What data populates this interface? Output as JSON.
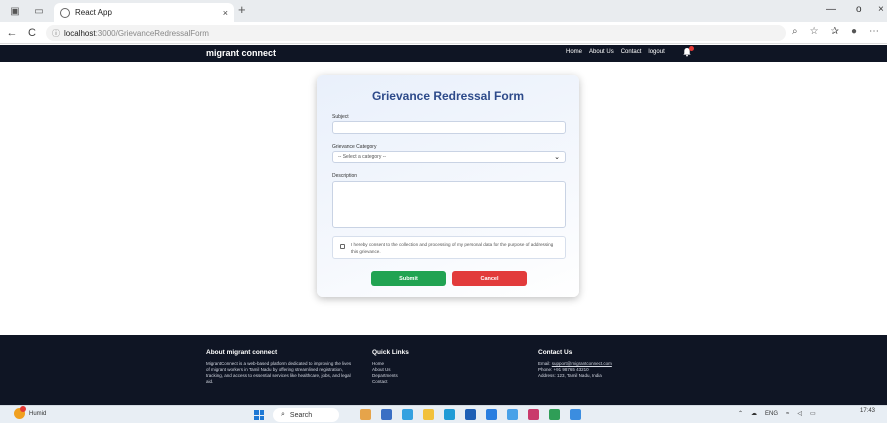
{
  "browser": {
    "tab_title": "React App",
    "tab_close": "×",
    "new_tab": "+",
    "url_host": "localhost",
    "url_path": ":3000/GrievanceRedressalForm",
    "back": "←",
    "reload": "C",
    "minimize": "—",
    "restore": "o",
    "close": "×"
  },
  "navbar": {
    "brand": "migrant connect",
    "links": [
      "Home",
      "About Us",
      "Contact",
      "logout"
    ]
  },
  "form": {
    "title": "Grievance Redressal Form",
    "subject_label": "Subject",
    "category_label": "Grievance Category",
    "category_selected": "-- Select a category --",
    "description_label": "Description",
    "consent_text": "I hereby consent to the collection and processing of my personal data for the purpose of addressing this grievance.",
    "submit_label": "Submit",
    "cancel_label": "Cancel",
    "submit_color": "#21a352",
    "cancel_color": "#e23b3b"
  },
  "footer": {
    "about_title": "About migrant connect",
    "about_text": "MigrantConnect is a web-based platform dedicated to improving the lives of migrant workers in Tamil Nadu by offering streamlined registration, tracking, and access to essential services like healthcare, jobs, and legal aid.",
    "links_title": "Quick Links",
    "links": [
      "Home",
      "About Us",
      "Departments",
      "Contact"
    ],
    "contact_title": "Contact Us",
    "email_label": "Email: ",
    "email": "support@migrantconnect.com",
    "phone": "Phone: +91 98765 43210",
    "address": "Address: 123, Tamil Nadu, India"
  },
  "taskbar": {
    "weather": "Humid",
    "search": "Search",
    "lang": "ENG",
    "time": "17:43"
  }
}
